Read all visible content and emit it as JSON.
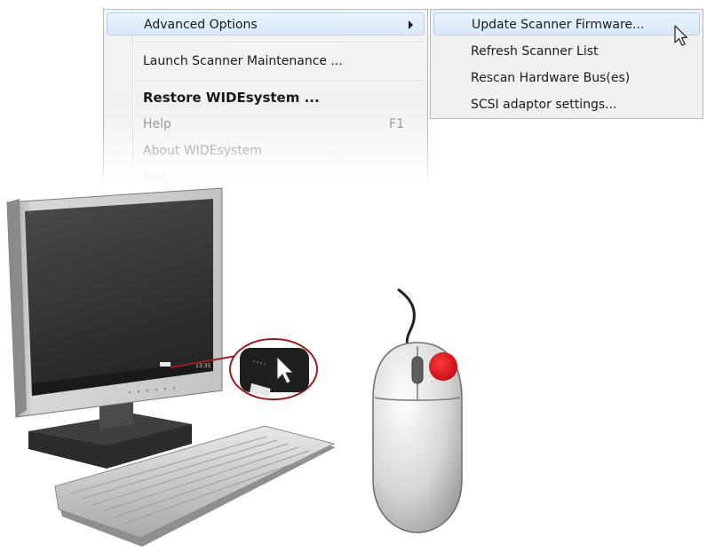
{
  "menu": {
    "items": [
      {
        "label": "Advanced Options",
        "has_submenu": true,
        "state": "highlighted"
      },
      {
        "label": "Launch Scanner Maintenance ...",
        "state": "normal"
      },
      {
        "label": "Restore WIDEsystem ...",
        "state": "bold"
      },
      {
        "label": "Help",
        "shortcut": "F1",
        "state": "disabled"
      },
      {
        "label": "About WIDEsystem",
        "state": "disabled"
      },
      {
        "label": "Exit",
        "state": "faded"
      }
    ]
  },
  "submenu": {
    "items": [
      {
        "label": "Update Scanner Firmware...",
        "state": "highlighted"
      },
      {
        "label": "Refresh Scanner List",
        "state": "normal"
      },
      {
        "label": "Rescan Hardware Bus(es)",
        "state": "normal"
      },
      {
        "label": "SCSI adaptor settings...",
        "state": "normal"
      }
    ]
  },
  "illustration": {
    "monitor_clock": "13:35",
    "callout_border_color": "#9b1c1c",
    "mouse_button_highlight_color": "#e0141e",
    "icons": [
      "computer-monitor",
      "keyboard",
      "tray-scanner-icon",
      "mouse-pointer",
      "mouse"
    ]
  },
  "colors": {
    "menu_background": "#f1f1f1",
    "highlight_background": "#dceafc",
    "highlight_border": "#b5d0f2",
    "disabled_text": "#9a9a9a"
  }
}
